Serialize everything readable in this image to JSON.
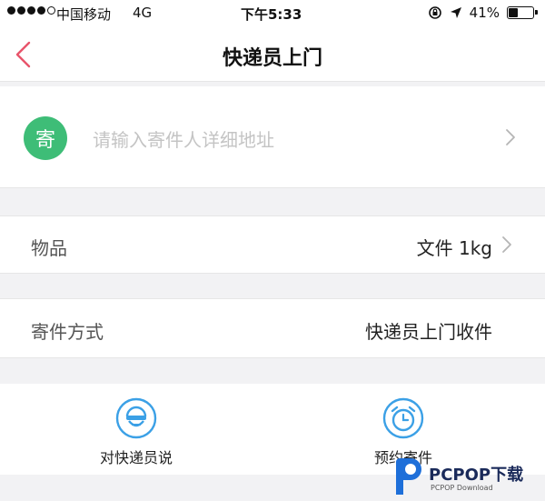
{
  "status_bar": {
    "carrier": "中国移动",
    "network": "4G",
    "time": "下午5:33",
    "battery": "41%",
    "battery_level": 0.41
  },
  "header": {
    "title": "快递员上门"
  },
  "sender": {
    "badge": "寄",
    "placeholder": "请输入寄件人详细地址"
  },
  "item": {
    "label": "物品",
    "value": "文件 1kg"
  },
  "method": {
    "label": "寄件方式",
    "value": "快递员上门收件"
  },
  "actions": [
    {
      "label": "对快递员说",
      "icon": "courier-icon"
    },
    {
      "label": "预约寄件",
      "icon": "alarm-clock-icon"
    }
  ],
  "watermark": {
    "brand": "PCPOP下载",
    "sub": "PCPOP Download"
  },
  "colors": {
    "accent": "#3ba0e6",
    "back_arrow": "#e8546b",
    "badge_green": "#3ebd77"
  }
}
